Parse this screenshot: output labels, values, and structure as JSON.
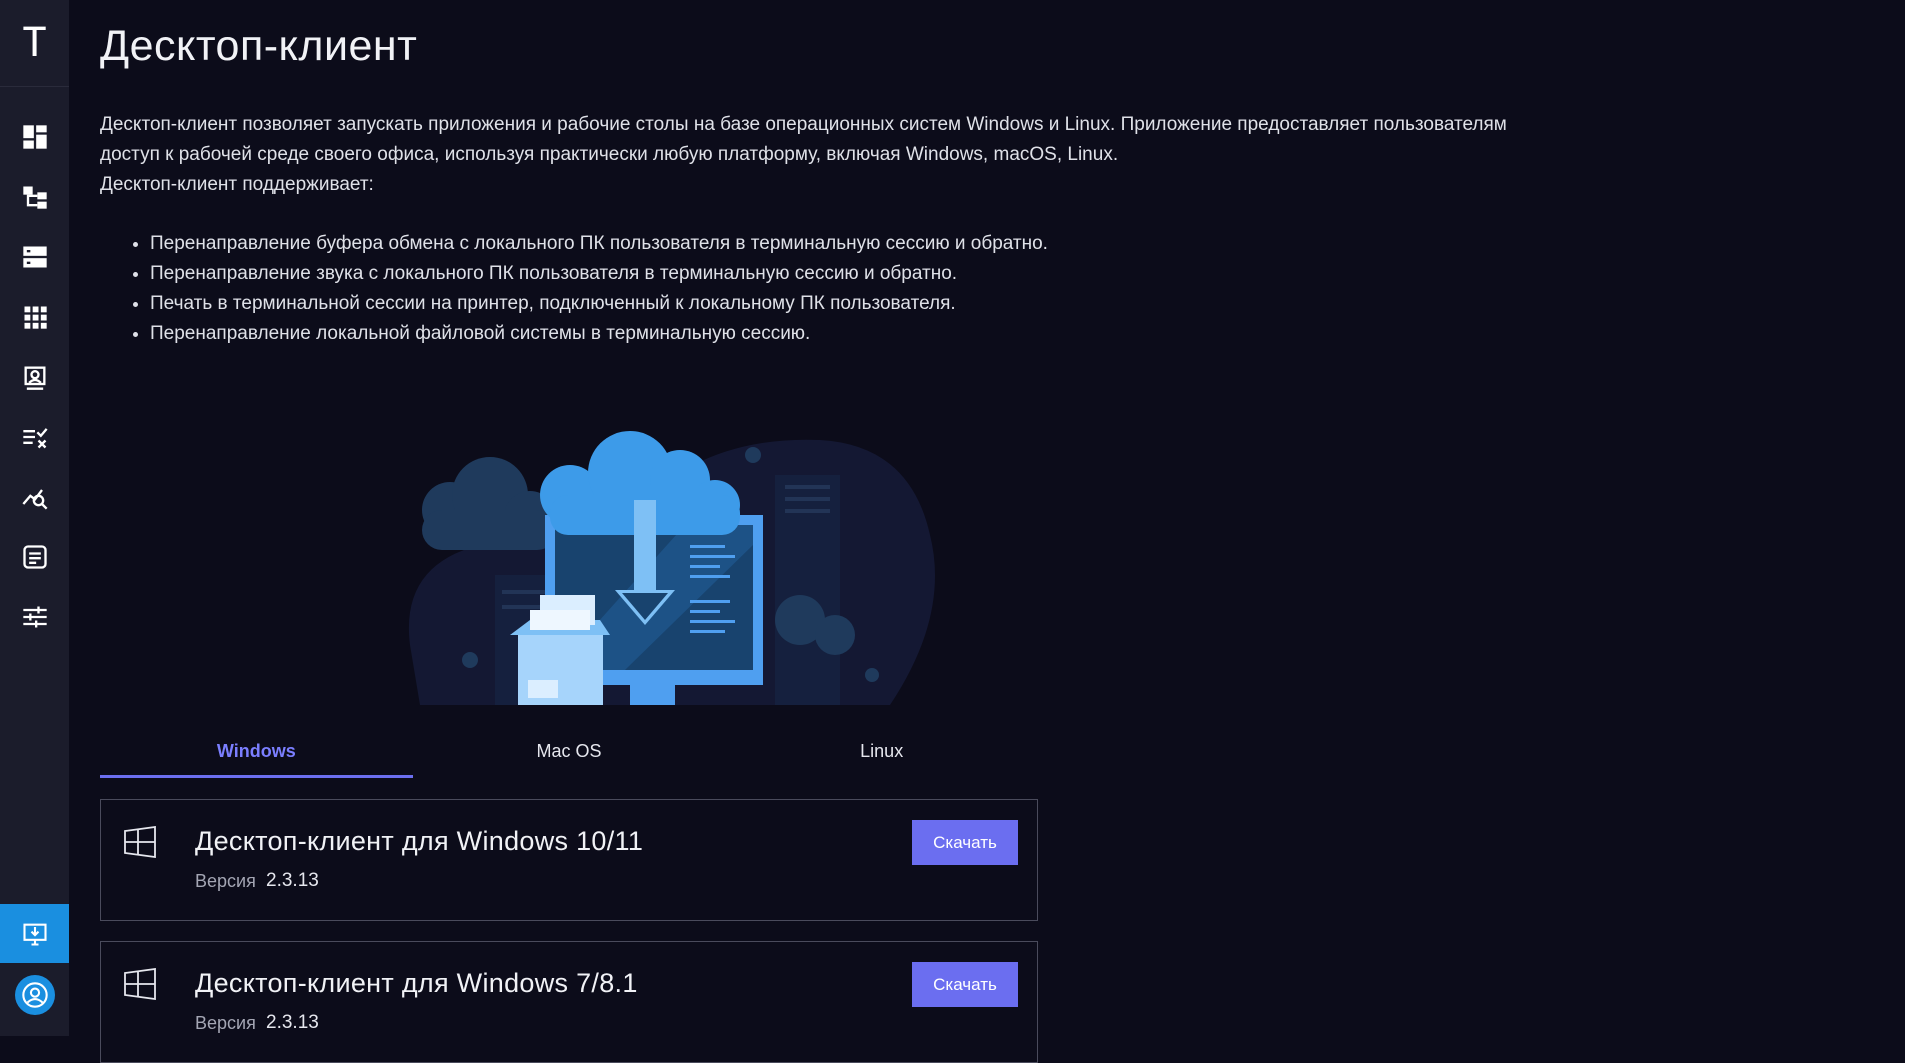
{
  "sidebar": {
    "logo": "T",
    "items": [
      {
        "icon": "dashboard-icon"
      },
      {
        "icon": "hierarchy-icon"
      },
      {
        "icon": "servers-icon"
      },
      {
        "icon": "apps-grid-icon"
      },
      {
        "icon": "user-profile-icon"
      },
      {
        "icon": "checklist-icon"
      },
      {
        "icon": "analytics-icon"
      },
      {
        "icon": "sessions-icon"
      },
      {
        "icon": "settings-sliders-icon"
      }
    ],
    "active_item": {
      "icon": "desktop-download-icon"
    },
    "avatar": {
      "icon": "user-avatar-icon"
    },
    "accent_color": "#1a8fe0"
  },
  "page": {
    "title": "Десктоп-клиент",
    "intro": "Десктоп-клиент позволяет запускать приложения и рабочие столы на базе операционных систем Windows и Linux. Приложение предоставляет пользователям доступ к рабочей среде своего офиса, используя практически любую платформу, включая Windows, macOS, Linux.",
    "supports_label": "Десктоп-клиент поддерживает:",
    "features": [
      "Перенаправление буфера обмена с локального ПК пользователя в терминальную сессию и обратно.",
      "Перенаправление звука с локального ПК пользователя в терминальную сессию и обратно.",
      "Печать в терминальной сессии на принтер, подключенный к локальному ПК пользователя.",
      "Перенаправление локальной файловой системы в терминальную сессию."
    ]
  },
  "tabs": [
    {
      "label": "Windows",
      "active": true
    },
    {
      "label": "Mac OS",
      "active": false
    },
    {
      "label": "Linux",
      "active": false
    }
  ],
  "cards": [
    {
      "icon": "windows-logo-icon",
      "title": "Десктоп-клиент для Windows 10/11",
      "version_label": "Версия",
      "version": "2.3.13",
      "button": "Скачать"
    },
    {
      "icon": "windows-logo-icon",
      "title": "Десктоп-клиент для Windows 7/8.1",
      "version_label": "Версия",
      "version": "2.3.13",
      "button": "Скачать"
    }
  ],
  "colors": {
    "background": "#0c0c1a",
    "sidebar": "#1b1c2b",
    "button": "#6b6ef0",
    "tab_active": "#7b7fff"
  }
}
